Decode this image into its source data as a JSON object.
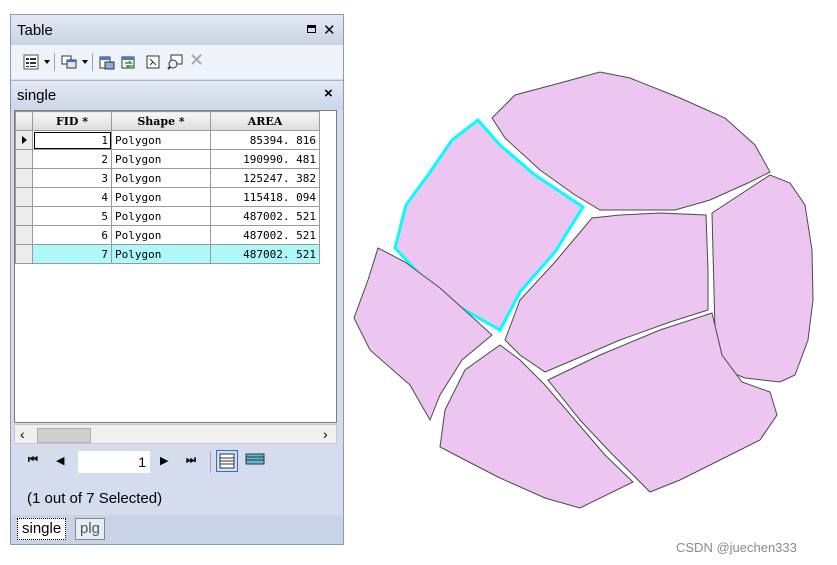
{
  "window": {
    "title": "Table",
    "maximize_icon": "maximize-icon",
    "close_icon": "close-icon"
  },
  "toolbar": {
    "buttons": [
      "table-options-icon",
      "related-tables-icon",
      "select-by-attributes-icon",
      "switch-selection-icon",
      "clear-selection-icon",
      "zoom-to-selected-icon",
      "delete-selected-icon"
    ]
  },
  "tab": {
    "title": "single",
    "close_label": "×"
  },
  "columns": [
    "FID *",
    "Shape *",
    "AREA"
  ],
  "rows": [
    {
      "fid": "1",
      "shape": "Polygon",
      "area": "85394. 816"
    },
    {
      "fid": "2",
      "shape": "Polygon",
      "area": "190990. 481"
    },
    {
      "fid": "3",
      "shape": "Polygon",
      "area": "125247. 382"
    },
    {
      "fid": "4",
      "shape": "Polygon",
      "area": "115418. 094"
    },
    {
      "fid": "5",
      "shape": "Polygon",
      "area": "487002. 521"
    },
    {
      "fid": "6",
      "shape": "Polygon",
      "area": "487002. 521"
    },
    {
      "fid": "7",
      "shape": "Polygon",
      "area": "487002. 521"
    }
  ],
  "selected_row_index": 6,
  "current_row_index": 0,
  "navigator": {
    "record": "1",
    "first": "⏮",
    "prev": "◀",
    "next": "▶",
    "last": "⏭"
  },
  "status": "(1 out of 7 Selected)",
  "bottom_tabs": [
    "single",
    "plg"
  ],
  "colors": {
    "polygon_fill": "#ecc6f0",
    "polygon_stroke": "#4a4a4a",
    "selected_stroke": "#00ffff",
    "selected_row": "#aef8f8"
  },
  "watermark": "CSDN @juechen333"
}
